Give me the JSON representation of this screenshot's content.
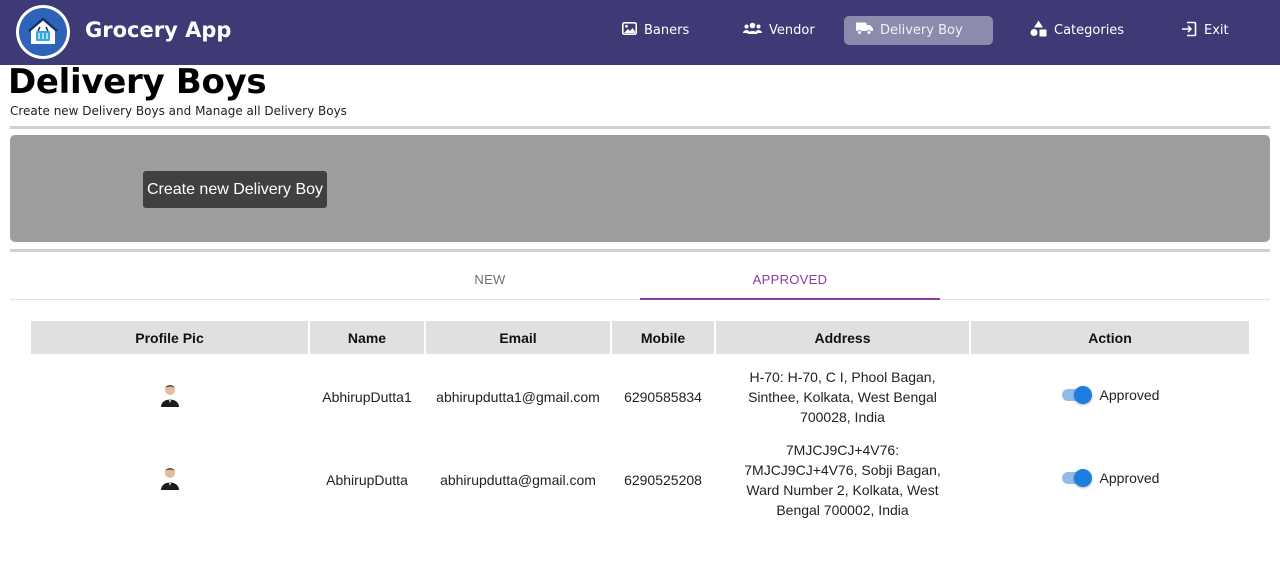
{
  "app": {
    "title": "Grocery App"
  },
  "nav": {
    "items": [
      {
        "label": "Baners",
        "icon": "image-icon"
      },
      {
        "label": "Vendor",
        "icon": "users-icon"
      },
      {
        "label": "Delivery Boy",
        "icon": "truck-icon",
        "active": true
      },
      {
        "label": "Categories",
        "icon": "shapes-icon"
      },
      {
        "label": "Exit",
        "icon": "exit-icon"
      }
    ]
  },
  "header": {
    "title": "Delivery Boys",
    "subtitle": "Create new Delivery Boys and Manage all Delivery Boys"
  },
  "create": {
    "button_label": "Create new Delivery Boy"
  },
  "tabs": [
    {
      "label": "NEW",
      "active": false
    },
    {
      "label": "APPROVED",
      "active": true
    }
  ],
  "table": {
    "columns": [
      "Profile Pic",
      "Name",
      "Email",
      "Mobile",
      "Address",
      "Action"
    ],
    "rows": [
      {
        "name": "AbhirupDutta1",
        "email": "abhirupdutta1@gmail.com",
        "mobile": "6290585834",
        "address": "H-70: H-70, C I, Phool Bagan, Sinthee, Kolkata, West Bengal 700028, India",
        "status": "Approved",
        "approved": true
      },
      {
        "name": "AbhirupDutta",
        "email": "abhirupdutta@gmail.com",
        "mobile": "6290525208",
        "address": "7MJCJ9CJ+4V76: 7MJCJ9CJ+4V76, Sobji Bagan, Ward Number 2, Kolkata, West Bengal 700002, India",
        "status": "Approved",
        "approved": true
      }
    ]
  },
  "colors": {
    "topbar": "#3e3a75",
    "active_nav": "#8c8bad",
    "tab_accent": "#8e3ba6",
    "toggle_on": "#1e7de0"
  }
}
